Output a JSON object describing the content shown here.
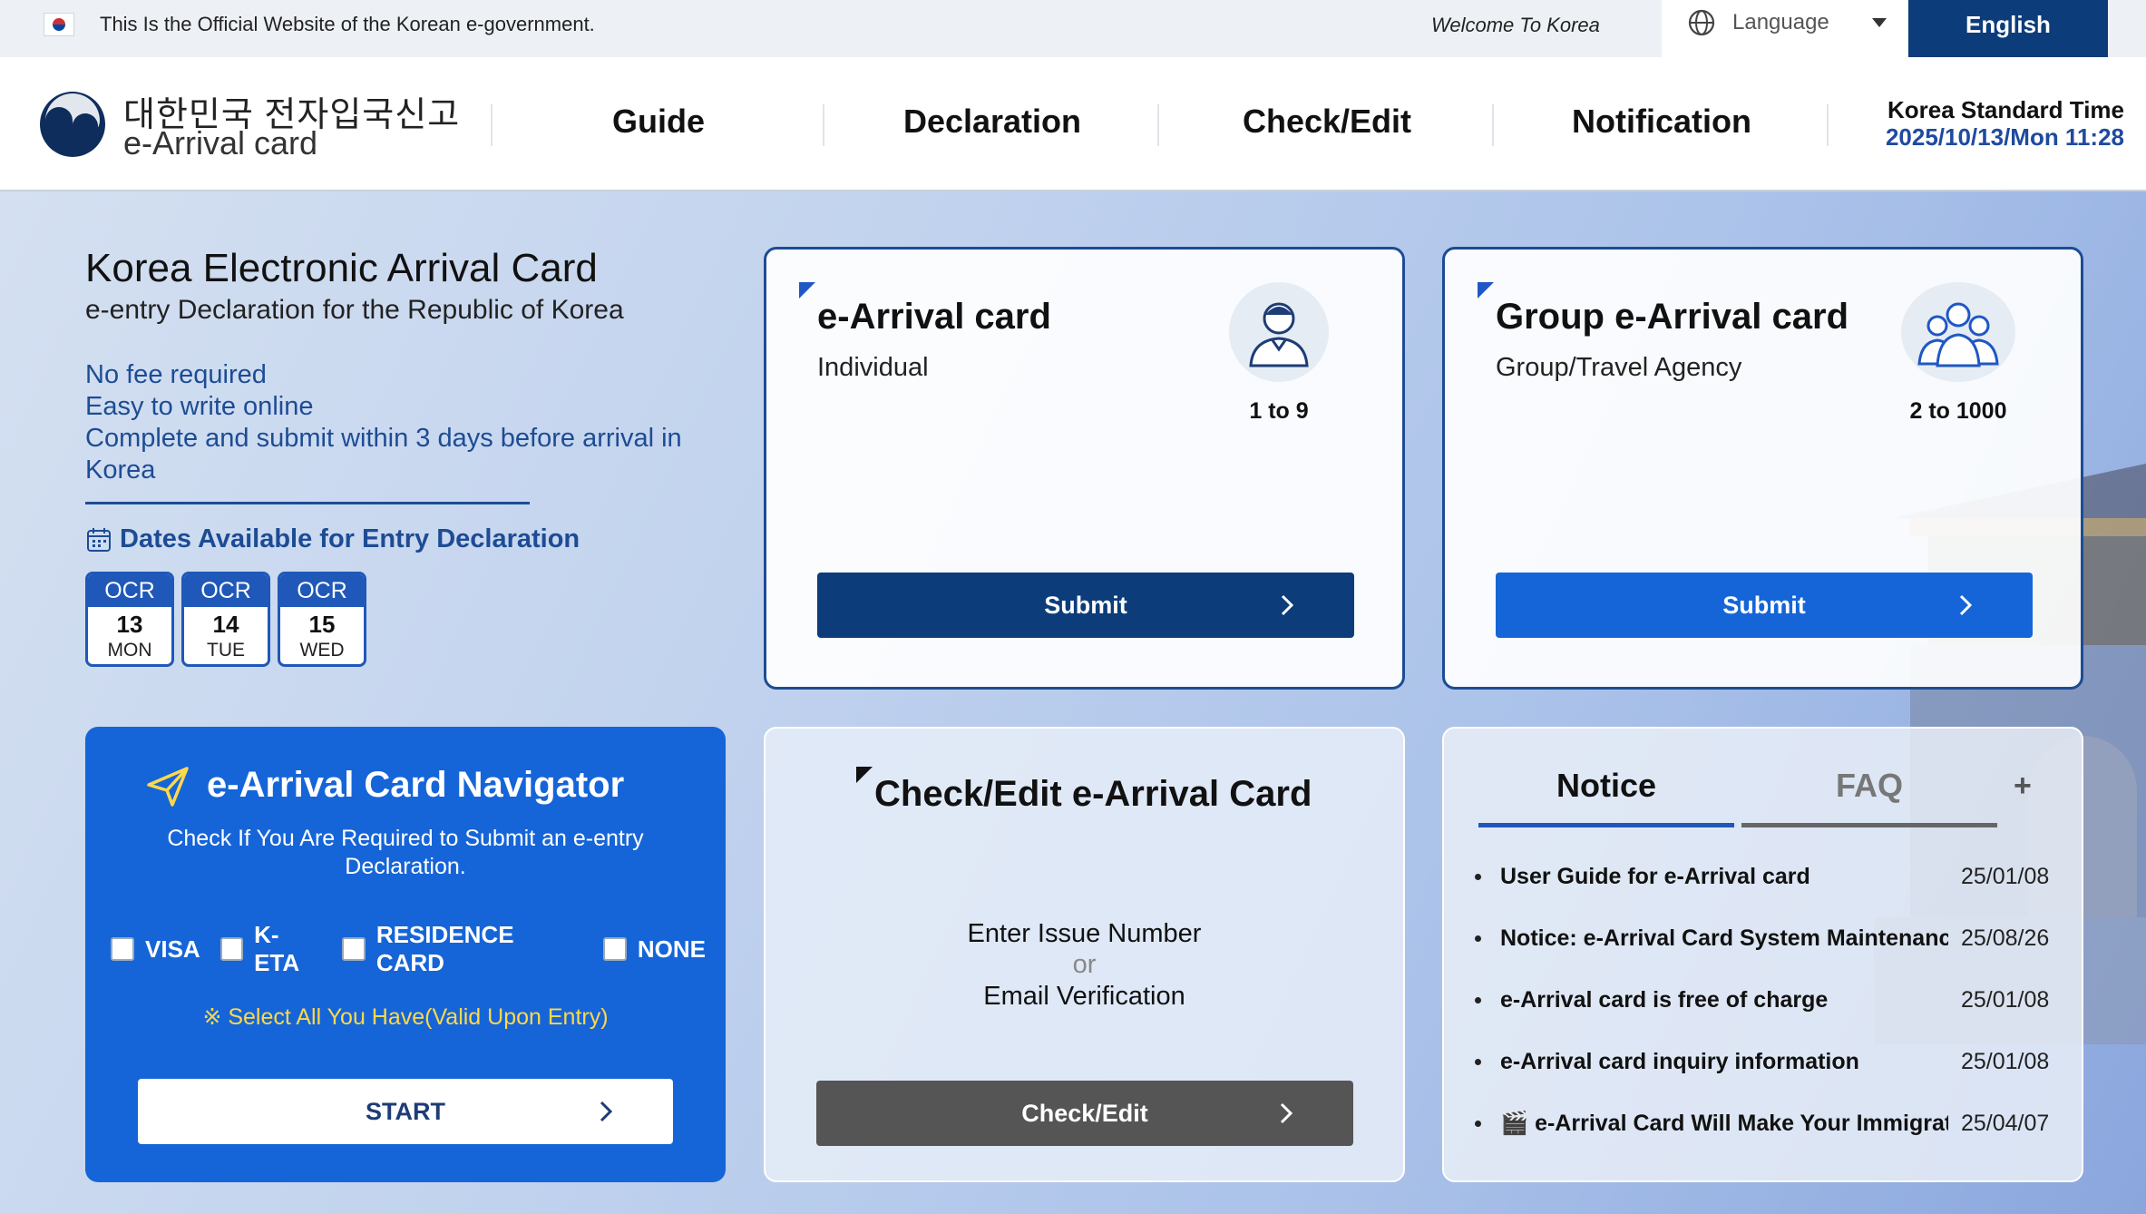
{
  "govbar": {
    "official_text": "This Is the Official Website of the Korean e-government.",
    "welcome": "Welcome To Korea",
    "language_label": "Language",
    "current_language": "English"
  },
  "header": {
    "logo_korean": "대한민국 전자입국신고",
    "logo_english": "e-Arrival card",
    "nav": [
      "Guide",
      "Declaration",
      "Check/Edit",
      "Notification"
    ],
    "time_title": "Korea Standard Time",
    "time_value": "2025/10/13/Mon 11:28"
  },
  "intro": {
    "title": "Korea Electronic Arrival Card",
    "subtitle": "e-entry Declaration for the Republic of Korea",
    "features": [
      "No fee required",
      "Easy to write online",
      "Complete and submit within 3 days before arrival in",
      "Korea"
    ],
    "dates_title": "Dates Available for Entry Declaration",
    "dates": [
      {
        "month": "OCR",
        "day": "13",
        "weekday": "MON"
      },
      {
        "month": "OCR",
        "day": "14",
        "weekday": "TUE"
      },
      {
        "month": "OCR",
        "day": "15",
        "weekday": "WED"
      }
    ]
  },
  "individual_card": {
    "title": "e-Arrival card",
    "subtitle": "Individual",
    "count": "1 to 9",
    "button": "Submit"
  },
  "group_card": {
    "title": "Group e-Arrival card",
    "subtitle": "Group/Travel Agency",
    "count": "2 to 1000",
    "button": "Submit"
  },
  "navigator": {
    "title": "e-Arrival Card Navigator",
    "description": "Check If You Are Required to Submit an e-entry Declaration.",
    "options": [
      "VISA",
      "K-ETA",
      "RESIDENCE CARD",
      "NONE"
    ],
    "hint": "※ Select All You Have(Valid Upon Entry)",
    "button": "START"
  },
  "check_edit": {
    "title": "Check/Edit e-Arrival Card",
    "line1": "Enter Issue Number",
    "or": "or",
    "line2": "Email Verification",
    "button": "Check/Edit"
  },
  "notice": {
    "tabs": [
      "Notice",
      "FAQ"
    ],
    "more": "+",
    "items": [
      {
        "text": "User Guide for e-Arrival card",
        "date": "25/01/08"
      },
      {
        "text": "Notice: e-Arrival Card System Maintenance",
        "date": "25/08/26"
      },
      {
        "text": "e-Arrival card is free of charge",
        "date": "25/01/08"
      },
      {
        "text": "e-Arrival card inquiry information",
        "date": "25/01/08"
      },
      {
        "text": "🎬 e-Arrival Card Will Make Your Immigration Easier",
        "date": "25/04/07"
      }
    ]
  },
  "colors": {
    "navy": "#0c3c7a",
    "blue": "#1565d8",
    "link_blue": "#1d4c94",
    "hint_yellow": "#ffd84a",
    "gray_button": "#555555"
  }
}
